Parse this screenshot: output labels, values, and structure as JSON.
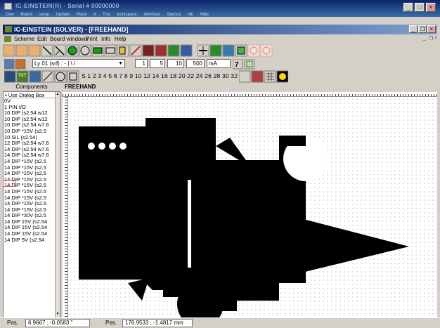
{
  "outer_window": {
    "title": "IC-EINSTEIN(R) - Serial # 00000000",
    "menu": [
      "Diev",
      "Board setup",
      "Update",
      "Place it",
      "The workspace",
      "Interface",
      "Special mk",
      "Help"
    ]
  },
  "mdi_window": {
    "title": "IC-EINSTEIN (SOLVER) - [FREEHAND]"
  },
  "menubar": {
    "items": [
      "Scheme",
      "Edit",
      "Board windows",
      "Print",
      "Info",
      "Help"
    ]
  },
  "toolbar2": {
    "layer_select": "Ly 01 (srf) : - | \\ /",
    "field1": "1",
    "field2": "5",
    "field3": "10",
    "field4": "500",
    "unit": "mA",
    "sizes_text": "S 1 2 3 4 5 6 7 8 9 10  12  14  16  18  20  22  24  26  28  30  32"
  },
  "toolbar3": {
    "txt_button": "TXT"
  },
  "panels": {
    "components_label": "Components",
    "canvas_tab": "FREEHAND"
  },
  "components": {
    "first": "Use Dialog Box",
    "items": [
      "0V",
      "1 PIN I/O",
      "10 DIP (s2.54 w12",
      "10 DIP (s2.54 w12",
      "10 DIP (s2.54 w7.6",
      "10 DIP *15V (s2.5",
      "10 SIL (s2.54)",
      "12 DIP (s2.54 w7.6",
      "14 DIP (s2.54 w7.6",
      "14 DIP (s2.54 w7.6",
      "14 DIP *15V (s2.5",
      "14 DIP *15V (s2.5",
      "14 DIP *15V (s2.5",
      "14 DIP *15V (s2.5",
      "14 DIP *15V (s2.5",
      "14 DIP *15V (s2.5",
      "14 DIP *15V (s2.5",
      "14 DIP *15V (s2.5",
      "14 DIP *15V (s2.5",
      "14 DIP *30V (s2.5",
      "14 DIP 15V (s2.54",
      "14 DIP 15V (s2.54",
      "14 DIP 15V (s2.54",
      "14 DIP 5V (s2.54"
    ]
  },
  "status": {
    "pos_label_1": "Pos.",
    "pos_value_1": "6.9667 ; -0.0583 \"",
    "pos_label_2": "Pos.",
    "pos_value_2": "176.9533 ; -1.4817 mm"
  }
}
